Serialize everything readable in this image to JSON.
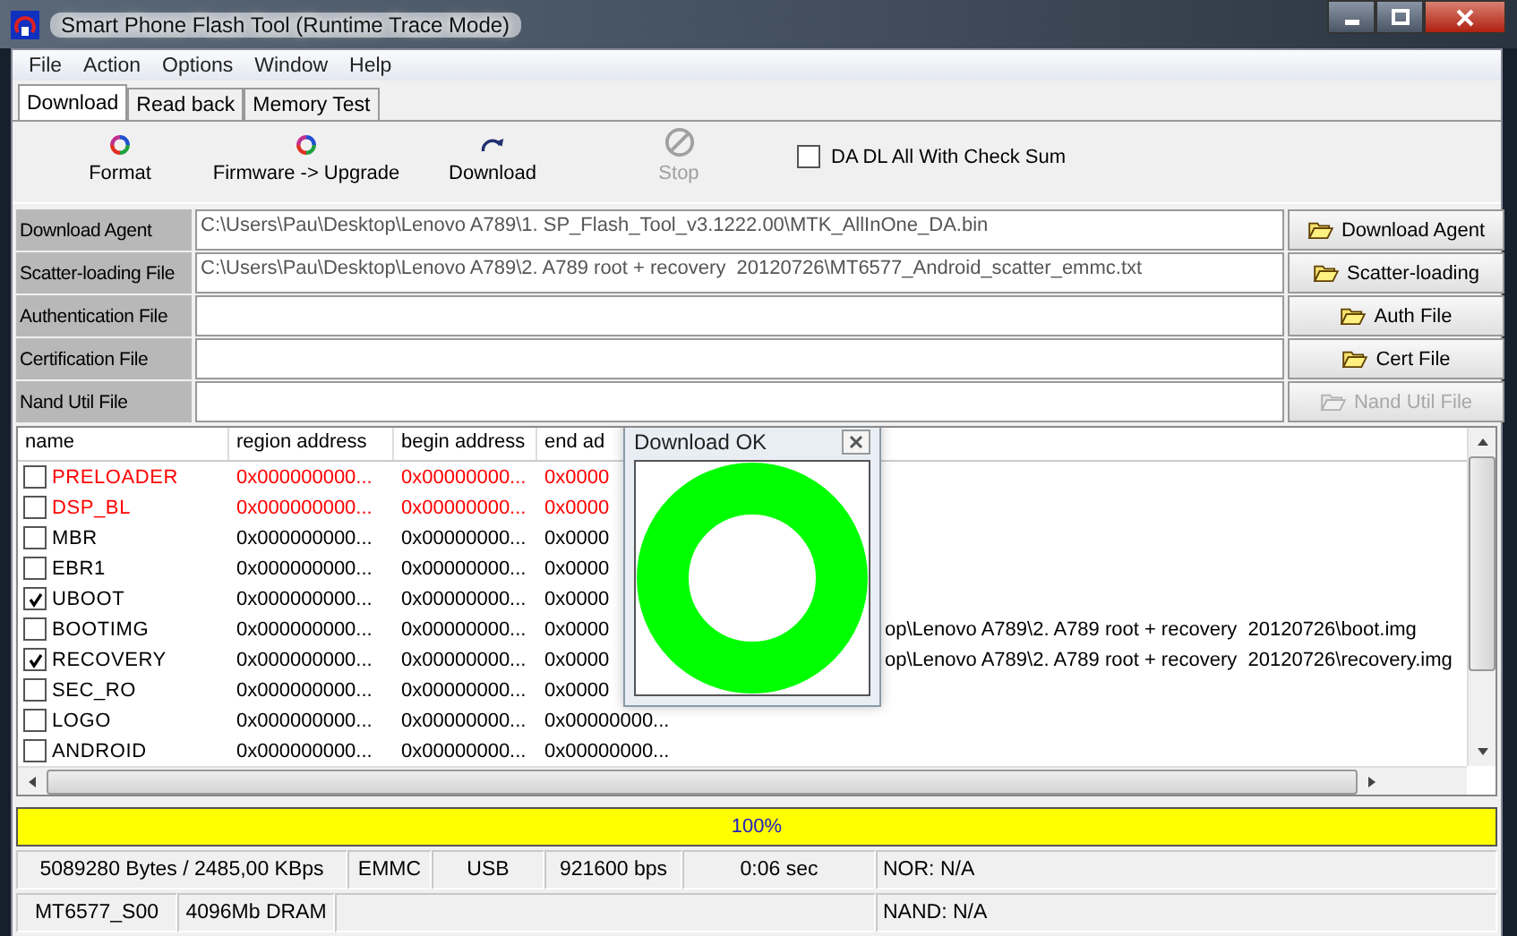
{
  "window": {
    "title": "Smart Phone Flash Tool (Runtime Trace Mode)"
  },
  "menu": [
    "File",
    "Action",
    "Options",
    "Window",
    "Help"
  ],
  "tabs": [
    {
      "label": "Download",
      "selected": true
    },
    {
      "label": "Read back",
      "selected": false
    },
    {
      "label": "Memory Test",
      "selected": false
    }
  ],
  "toolbar": {
    "buttons": [
      {
        "label": "Format",
        "kind": "format",
        "disabled": false
      },
      {
        "label": "Firmware -> Upgrade",
        "kind": "firmware",
        "disabled": false
      },
      {
        "label": "Download",
        "kind": "download",
        "disabled": false
      },
      {
        "label": "Stop",
        "kind": "stop",
        "disabled": true
      }
    ],
    "checksum": {
      "label": "DA DL All With Check Sum",
      "checked": false
    }
  },
  "files": [
    {
      "label": "Download Agent",
      "value": "C:\\Users\\Pau\\Desktop\\Lenovo A789\\1. SP_Flash_Tool_v3.1222.00\\MTK_AllInOne_DA.bin",
      "button": "Download Agent",
      "disabled": false
    },
    {
      "label": "Scatter-loading File",
      "value": "C:\\Users\\Pau\\Desktop\\Lenovo A789\\2. A789 root + recovery  20120726\\MT6577_Android_scatter_emmc.txt",
      "button": "Scatter-loading",
      "disabled": false
    },
    {
      "label": "Authentication File",
      "button": "Auth File",
      "disabled": false
    },
    {
      "label": "Certification File",
      "button": "Cert File",
      "disabled": false
    },
    {
      "label": "Nand Util File",
      "button": "Nand Util File",
      "disabled": true
    }
  ],
  "table": {
    "columns": [
      "name",
      "region address",
      "begin address",
      "end ad"
    ],
    "rows": [
      {
        "name": "PRELOADER",
        "checked": false,
        "color": "#ff0000",
        "region": "0x000000000...",
        "begin": "0x00000000...",
        "end": "0x0000"
      },
      {
        "name": "DSP_BL",
        "checked": false,
        "color": "#ff0000",
        "region": "0x000000000...",
        "begin": "0x00000000...",
        "end": "0x0000"
      },
      {
        "name": "MBR",
        "checked": false,
        "color": "#000000",
        "region": "0x000000000...",
        "begin": "0x00000000...",
        "end": "0x0000"
      },
      {
        "name": "EBR1",
        "checked": false,
        "color": "#000000",
        "region": "0x000000000...",
        "begin": "0x00000000...",
        "end": "0x0000"
      },
      {
        "name": "UBOOT",
        "checked": true,
        "color": "#000000",
        "region": "0x000000000...",
        "begin": "0x00000000...",
        "end": "0x0000"
      },
      {
        "name": "BOOTIMG",
        "checked": false,
        "color": "#000000",
        "region": "0x000000000...",
        "begin": "0x00000000...",
        "end": "0x0000",
        "location": "op\\Lenovo A789\\2. A789 root + recovery  20120726\\boot.img"
      },
      {
        "name": "RECOVERY",
        "checked": true,
        "color": "#000000",
        "region": "0x000000000...",
        "begin": "0x00000000...",
        "end": "0x0000",
        "location": "op\\Lenovo A789\\2. A789 root + recovery  20120726\\recovery.img"
      },
      {
        "name": "SEC_RO",
        "checked": false,
        "color": "#000000",
        "region": "0x000000000...",
        "begin": "0x00000000...",
        "end": "0x0000"
      },
      {
        "name": "LOGO",
        "checked": false,
        "color": "#000000",
        "region": "0x000000000...",
        "begin": "0x00000000...",
        "end": "0x00000000..."
      },
      {
        "name": "ANDROID",
        "checked": false,
        "color": "#000000",
        "region": "0x000000000...",
        "begin": "0x00000000...",
        "end": "0x00000000..."
      }
    ]
  },
  "dialog": {
    "title": "Download OK"
  },
  "progress": {
    "level": 1,
    "label": "100%"
  },
  "status": [
    [
      "5089280 Bytes / 2485,00 KBps",
      "EMMC",
      "USB",
      "921600 bps",
      "0:06 sec",
      "NOR: N/A"
    ],
    [
      "MT6577_S00",
      "4096Mb DRAM",
      "NAND: N/A"
    ]
  ]
}
